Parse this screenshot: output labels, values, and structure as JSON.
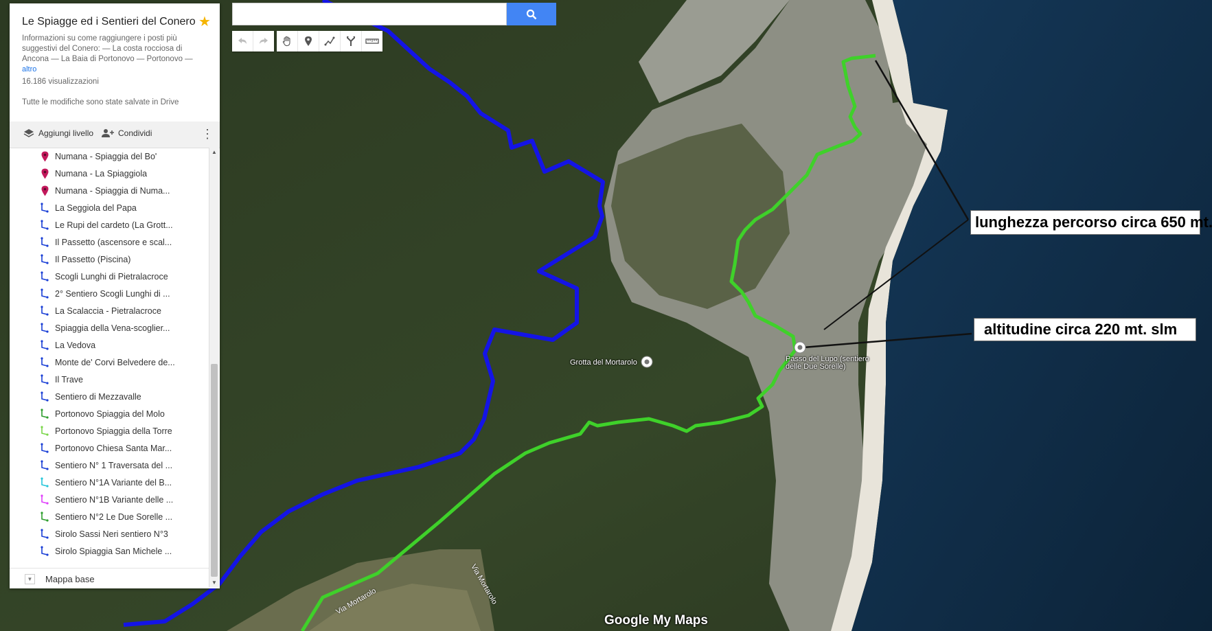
{
  "panel": {
    "title": "Le Spiagge ed i Sentieri del Conero",
    "description": "Informazioni su come raggiungere i posti  più suggestivi del Conero: — La costa rocciosa di Ancona — La Baia di Portonovo — Portonovo —",
    "more": "altro",
    "views": "16.186 visualizzazioni",
    "saved": "Tutte le modifiche sono state salvate in Drive",
    "add_layer": "Aggiungi livello",
    "share": "Condividi",
    "base_map": "Mappa base"
  },
  "layers": [
    {
      "label": "Numana - Spiaggia del Bo'",
      "icon": "pin",
      "color": "#c2185b"
    },
    {
      "label": "Numana - La Spiaggiola",
      "icon": "pin",
      "color": "#c2185b"
    },
    {
      "label": "Numana - Spiaggia di Numa...",
      "icon": "pin",
      "color": "#c2185b"
    },
    {
      "label": "La Seggiola del Papa",
      "icon": "route",
      "color": "#1a3fd6"
    },
    {
      "label": "Le Rupi del cardeto (La Grott...",
      "icon": "route",
      "color": "#1a3fd6"
    },
    {
      "label": "Il Passetto (ascensore e scal...",
      "icon": "route",
      "color": "#1a3fd6"
    },
    {
      "label": "Il Passetto (Piscina)",
      "icon": "route",
      "color": "#1a3fd6"
    },
    {
      "label": "Scogli Lunghi di Pietralacroce",
      "icon": "route",
      "color": "#1a3fd6"
    },
    {
      "label": "2° Sentiero Scogli Lunghi di ...",
      "icon": "route",
      "color": "#1a3fd6"
    },
    {
      "label": "La Scalaccia - Pietralacroce",
      "icon": "route",
      "color": "#1a3fd6"
    },
    {
      "label": "Spiaggia della Vena-scoglier...",
      "icon": "route",
      "color": "#1a3fd6"
    },
    {
      "label": "La Vedova",
      "icon": "route",
      "color": "#1a3fd6"
    },
    {
      "label": "Monte de' Corvi Belvedere de...",
      "icon": "route",
      "color": "#1a3fd6"
    },
    {
      "label": "Il Trave",
      "icon": "route",
      "color": "#1a3fd6"
    },
    {
      "label": "Sentiero di Mezzavalle",
      "icon": "route",
      "color": "#1a3fd6"
    },
    {
      "label": "Portonovo Spiaggia del Molo",
      "icon": "route",
      "color": "#2e9e2e"
    },
    {
      "label": "Portonovo Spiaggia della Torre",
      "icon": "route",
      "color": "#7ad64a"
    },
    {
      "label": "Portonovo Chiesa Santa Mar...",
      "icon": "route",
      "color": "#1a3fd6"
    },
    {
      "label": "Sentiero N° 1 Traversata del ...",
      "icon": "route",
      "color": "#1a3fd6"
    },
    {
      "label": "Sentiero N°1A Variante del B...",
      "icon": "route",
      "color": "#26c6da"
    },
    {
      "label": "Sentiero N°1B Variante delle ...",
      "icon": "route",
      "color": "#e040fb"
    },
    {
      "label": "Sentiero N°2 Le Due Sorelle ...",
      "icon": "route",
      "color": "#2e9e2e"
    },
    {
      "label": "Sirolo Sassi Neri sentiero N°3",
      "icon": "route",
      "color": "#1a3fd6"
    },
    {
      "label": "Sirolo Spiaggia San Michele ...",
      "icon": "route",
      "color": "#1a3fd6"
    }
  ],
  "search": {
    "value": ""
  },
  "map": {
    "poi_grotta": "Grotta del Mortarolo",
    "poi_passo": "Passo del Lupo (sentiero delle Due Sorelle)",
    "road_1": "Via Mortarolo",
    "road_2": "Via Mortarolo",
    "logo": "Google My Maps"
  },
  "callouts": {
    "length": "lunghezza percorso circa 650 mt.",
    "altitude": "altitudine circa 220 mt. slm"
  },
  "colors": {
    "blue_route": "#1414e6",
    "green_route": "#3fd12a",
    "search_button": "#4285f4",
    "star": "#f5b400"
  },
  "icons": {
    "undo": "undo-icon",
    "redo": "redo-icon",
    "pan": "hand-icon",
    "marker": "add-marker-icon",
    "line": "draw-line-icon",
    "directions": "directions-icon",
    "measure": "ruler-icon",
    "search": "search-icon"
  }
}
